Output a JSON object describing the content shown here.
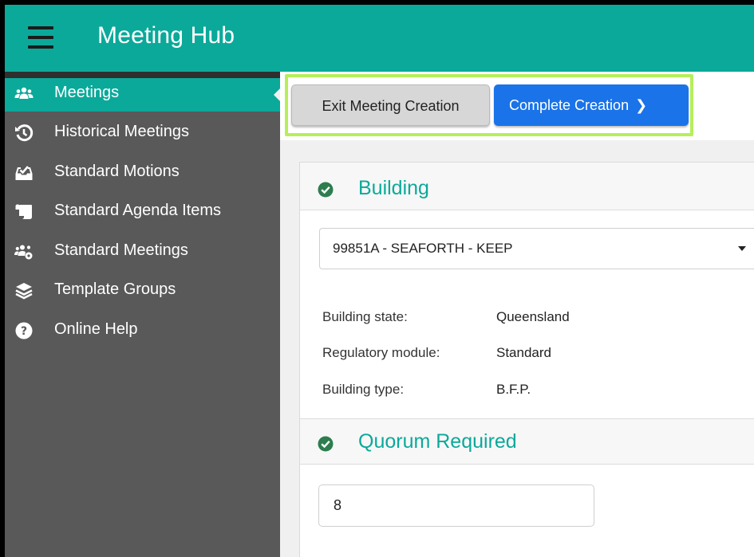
{
  "header": {
    "title": "Meeting Hub",
    "menu_icon": "hamburger-menu-icon"
  },
  "sidebar": {
    "items": [
      {
        "label": "Meetings",
        "icon": "users-icon",
        "active": true
      },
      {
        "label": "Historical Meetings",
        "icon": "history-icon",
        "active": false
      },
      {
        "label": "Standard Motions",
        "icon": "inbox-check-icon",
        "active": false
      },
      {
        "label": "Standard Agenda Items",
        "icon": "scroll-icon",
        "active": false
      },
      {
        "label": "Standard Meetings",
        "icon": "users-cog-icon",
        "active": false
      },
      {
        "label": "Template Groups",
        "icon": "layers-icon",
        "active": false
      },
      {
        "label": "Online Help",
        "icon": "help-circle-icon",
        "active": false
      }
    ]
  },
  "toolbar": {
    "exit_label": "Exit Meeting Creation",
    "complete_label": "Complete Creation",
    "complete_icon": "chevron-right-icon"
  },
  "building": {
    "section_title": "Building",
    "selected": "99851A - SEAFORTH - KEEP",
    "state_label": "Building state:",
    "state_value": "Queensland",
    "module_label": "Regulatory module:",
    "module_value": "Standard",
    "type_label": "Building type:",
    "type_value": "B.F.P."
  },
  "quorum": {
    "section_title": "Quorum Required",
    "value": "8"
  },
  "colors": {
    "accent": "#0ba99a",
    "sidebar": "#595959",
    "primary_button": "#1a73e8",
    "highlight": "#b6ef5a",
    "check": "#2e7d4f"
  }
}
